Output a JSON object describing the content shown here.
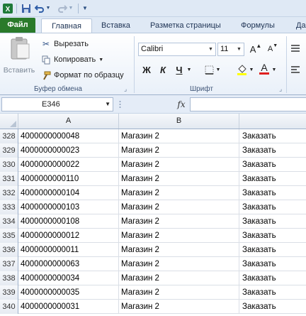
{
  "quick_access": {
    "icons": [
      "excel-app-icon",
      "save-icon",
      "undo-icon",
      "undo-dropdown-icon",
      "redo-icon",
      "redo-dropdown-icon",
      "customize-toolbar-icon"
    ]
  },
  "tabs": {
    "file": "Файл",
    "home": "Главная",
    "insert": "Вставка",
    "page_layout": "Разметка страницы",
    "formulas": "Формулы",
    "data": "Да"
  },
  "clipboard": {
    "paste_label": "Вставить",
    "cut_label": "Вырезать",
    "copy_label": "Копировать",
    "format_painter_label": "Формат по образцу",
    "group_label": "Буфер обмена"
  },
  "font": {
    "name": "Calibri",
    "size": "11",
    "bold": "Ж",
    "italic": "К",
    "underline": "Ч",
    "font_color_letter": "А",
    "grow_letter": "A",
    "shrink_letter": "A",
    "group_label": "Шрифт",
    "fill_color": "#ffff00",
    "font_color": "#e02020"
  },
  "formula_bar": {
    "name_box": "E346",
    "fx_label": "fx",
    "value": ""
  },
  "columns": [
    "A",
    "B"
  ],
  "rows": [
    {
      "num": "328",
      "a": "4000000000048",
      "b": "Магазин 2",
      "c": "Заказать"
    },
    {
      "num": "329",
      "a": "4000000000023",
      "b": "Магазин 2",
      "c": "Заказать"
    },
    {
      "num": "330",
      "a": "4000000000022",
      "b": "Магазин 2",
      "c": "Заказать"
    },
    {
      "num": "331",
      "a": "4000000000110",
      "b": "Магазин 2",
      "c": "Заказать"
    },
    {
      "num": "332",
      "a": "4000000000104",
      "b": "Магазин 2",
      "c": "Заказать"
    },
    {
      "num": "333",
      "a": "4000000000103",
      "b": "Магазин 2",
      "c": "Заказать"
    },
    {
      "num": "334",
      "a": "4000000000108",
      "b": "Магазин 2",
      "c": "Заказать"
    },
    {
      "num": "335",
      "a": "4000000000012",
      "b": "Магазин 2",
      "c": "Заказать"
    },
    {
      "num": "336",
      "a": "4000000000011",
      "b": "Магазин 2",
      "c": "Заказать"
    },
    {
      "num": "337",
      "a": "4000000000063",
      "b": "Магазин 2",
      "c": "Заказать"
    },
    {
      "num": "338",
      "a": "4000000000034",
      "b": "Магазин 2",
      "c": "Заказать"
    },
    {
      "num": "339",
      "a": "4000000000035",
      "b": "Магазин 2",
      "c": "Заказать"
    },
    {
      "num": "340",
      "a": "4000000000031",
      "b": "Магазин 2",
      "c": "Заказать"
    }
  ]
}
